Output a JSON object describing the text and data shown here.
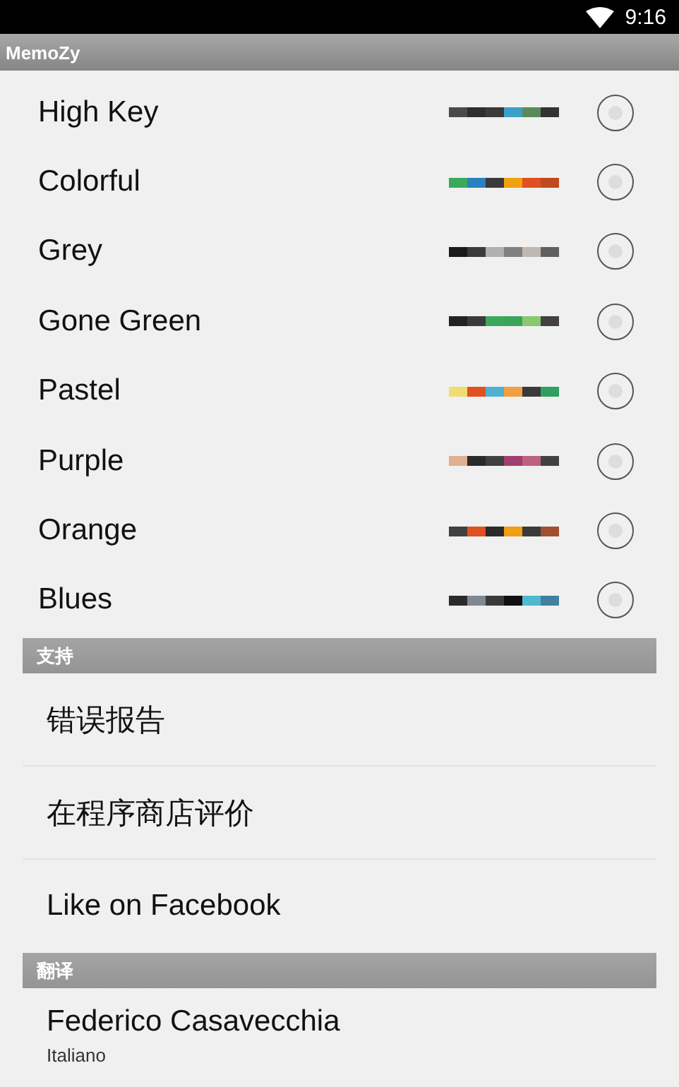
{
  "status_bar": {
    "time": "9:16"
  },
  "app_bar": {
    "title": "MemoZy"
  },
  "themes": [
    {
      "name": "High Key",
      "selected": false,
      "swatches": [
        {
          "color": "#4a4a4a"
        },
        {
          "color": "#2e2e2e"
        },
        {
          "color": "#3a3a3a"
        },
        {
          "color": "#3aa0c8"
        },
        {
          "color": "#5a8a5a"
        },
        {
          "color": "#333333"
        }
      ]
    },
    {
      "name": "Colorful",
      "selected": false,
      "swatches": [
        {
          "color": "#3aaa5a"
        },
        {
          "color": "#2a80c0"
        },
        {
          "color": "#3a3a3a"
        },
        {
          "color": "#f0a010"
        },
        {
          "color": "#e05020"
        },
        {
          "color": "#c04a20"
        }
      ]
    },
    {
      "name": "Grey",
      "selected": false,
      "swatches": [
        {
          "color": "#1a1a1a"
        },
        {
          "color": "#3a3a3a"
        },
        {
          "color": "#b0b0b0"
        },
        {
          "color": "#808080"
        },
        {
          "color": "#c0b8b0"
        },
        {
          "color": "#606060"
        }
      ]
    },
    {
      "name": "Gone Green",
      "selected": false,
      "swatches": [
        {
          "color": "#222222"
        },
        {
          "color": "#3a3a3a"
        },
        {
          "color": "#3aaa5a"
        },
        {
          "color": "#3aa55a"
        },
        {
          "color": "#8ac870"
        },
        {
          "color": "#444040"
        }
      ]
    },
    {
      "name": "Pastel",
      "selected": false,
      "swatches": [
        {
          "color": "#f0dc70"
        },
        {
          "color": "#e05020"
        },
        {
          "color": "#50b0d0"
        },
        {
          "color": "#f0a040"
        },
        {
          "color": "#3a3a3a"
        },
        {
          "color": "#30a060"
        }
      ]
    },
    {
      "name": "Purple",
      "selected": false,
      "swatches": [
        {
          "color": "#e0b090"
        },
        {
          "color": "#2a2a2a"
        },
        {
          "color": "#404040"
        },
        {
          "color": "#a04070"
        },
        {
          "color": "#c06080"
        },
        {
          "color": "#414141"
        }
      ]
    },
    {
      "name": "Orange",
      "selected": false,
      "swatches": [
        {
          "color": "#404040"
        },
        {
          "color": "#e05020"
        },
        {
          "color": "#2a2a2a"
        },
        {
          "color": "#f0a010"
        },
        {
          "color": "#3a3a3a"
        },
        {
          "color": "#a05030"
        }
      ]
    },
    {
      "name": "Blues",
      "selected": false,
      "swatches": [
        {
          "color": "#2a2a2a"
        },
        {
          "color": "#808890"
        },
        {
          "color": "#3a3a3a"
        },
        {
          "color": "#111111"
        },
        {
          "color": "#50b8d0"
        },
        {
          "color": "#4080a0"
        }
      ]
    }
  ],
  "sections": [
    {
      "header": "支持",
      "items": [
        {
          "title": "错误报告"
        },
        {
          "title": "在程序商店评价"
        },
        {
          "title": "Like on Facebook"
        }
      ]
    },
    {
      "header": "翻译",
      "items": [
        {
          "title": "Federico Casavecchia",
          "subtitle": "Italiano"
        }
      ]
    }
  ]
}
